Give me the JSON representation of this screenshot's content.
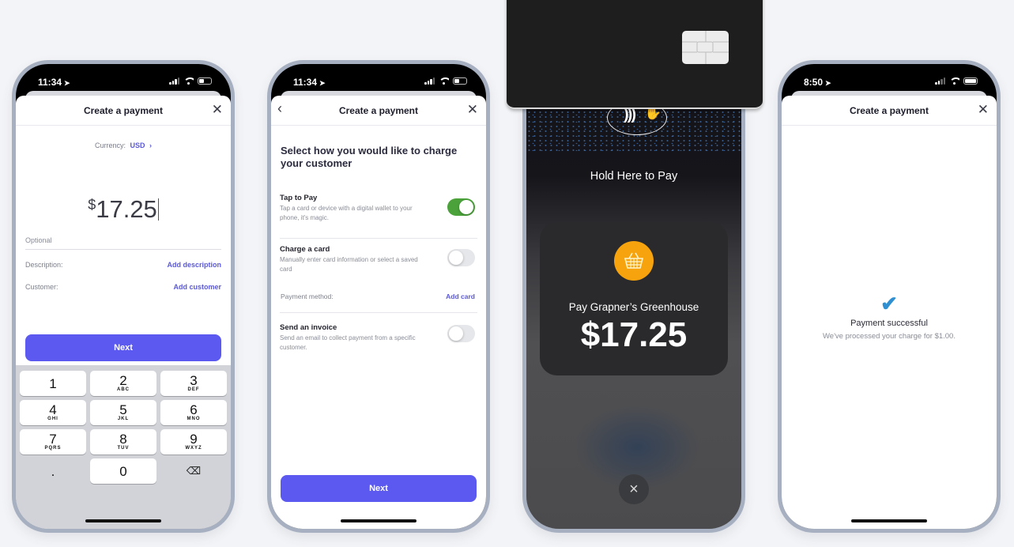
{
  "phones": [
    {
      "status": {
        "time": "11:34",
        "location_icon": "location-arrow-icon"
      },
      "header": {
        "title": "Create a payment",
        "close_icon": "close-icon"
      },
      "currency": {
        "label": "Currency:",
        "value": "USD",
        "chevron": "›"
      },
      "amount": {
        "symbol": "$",
        "value": "17.25"
      },
      "optional_placeholder": "Optional",
      "description": {
        "label": "Description:",
        "action": "Add description"
      },
      "customer": {
        "label": "Customer:",
        "action": "Add customer"
      },
      "next_label": "Next",
      "keypad": [
        {
          "digit": "1",
          "letters": ""
        },
        {
          "digit": "2",
          "letters": "ABC"
        },
        {
          "digit": "3",
          "letters": "DEF"
        },
        {
          "digit": "4",
          "letters": "GHI"
        },
        {
          "digit": "5",
          "letters": "JKL"
        },
        {
          "digit": "6",
          "letters": "MNO"
        },
        {
          "digit": "7",
          "letters": "PQRS"
        },
        {
          "digit": "8",
          "letters": "TUV"
        },
        {
          "digit": "9",
          "letters": "WXYZ"
        },
        {
          "digit": ".",
          "letters": ""
        },
        {
          "digit": "0",
          "letters": ""
        },
        {
          "digit": "⌫",
          "letters": ""
        }
      ]
    },
    {
      "status": {
        "time": "11:34"
      },
      "header": {
        "title": "Create a payment",
        "back_icon": "‹",
        "close_icon": "×"
      },
      "heading": "Select how you would like to charge your customer",
      "options": [
        {
          "title": "Tap to Pay",
          "subtitle": "Tap a card or device with a digital wallet to your phone, it's magic.",
          "enabled": true
        },
        {
          "title": "Charge a card",
          "subtitle": "Manually enter card information or select a saved card",
          "enabled": false
        },
        {
          "title": "Send an invoice",
          "subtitle": "Send an email to collect payment from a specific customer.",
          "enabled": false
        }
      ],
      "payment_method": {
        "label": "Payment method:",
        "action": "Add card"
      },
      "next_label": "Next"
    },
    {
      "hold_text": "Hold Here to Pay",
      "merchant": "Pay Grapner’s Greenhouse",
      "amount": "$17.25",
      "cancel_icon": "×"
    },
    {
      "status": {
        "time": "8:50"
      },
      "header": {
        "title": "Create a payment",
        "close_icon": "×"
      },
      "success": {
        "icon": "✔",
        "title": "Payment successful",
        "message": "We've processed your charge for $1.00."
      }
    }
  ],
  "colors": {
    "accent": "#5b59f0",
    "link": "#5b59d8",
    "toggle_on": "#4ba23b",
    "merchant": "#f6a30d",
    "check": "#2f8fd0"
  }
}
